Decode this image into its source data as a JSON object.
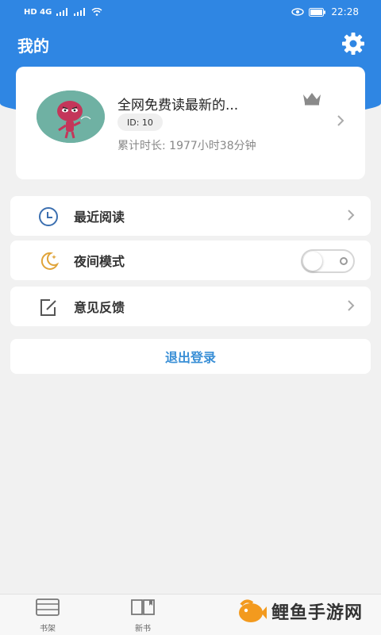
{
  "status_bar": {
    "left_text": "HD 4G",
    "time": "22:28"
  },
  "header": {
    "title": "我的",
    "background_color": "#2f86e3"
  },
  "profile": {
    "username": "全网免费读最新的...",
    "id_label": "ID: 10",
    "read_time": "累计时长: 1977小时38分钟"
  },
  "menu": {
    "recent": {
      "label": "最近阅读",
      "icon": "clock-icon"
    },
    "night_mode": {
      "label": "夜间模式",
      "icon": "moon-icon",
      "enabled": false
    },
    "feedback": {
      "label": "意见反馈",
      "icon": "edit-icon"
    }
  },
  "logout": {
    "label": "退出登录",
    "color": "#3a8fd6"
  },
  "tabs": [
    {
      "label": "书架",
      "icon": "bookshelf-icon"
    },
    {
      "label": "新书",
      "icon": "book-open-icon"
    }
  ],
  "watermark": {
    "text": "鲤鱼手游网"
  }
}
